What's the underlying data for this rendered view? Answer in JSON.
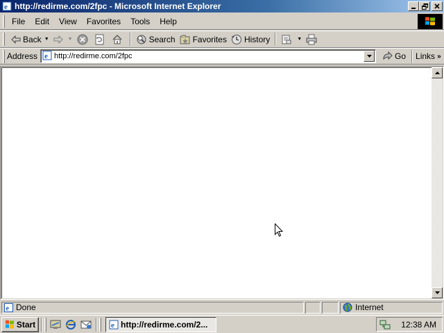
{
  "window": {
    "title": "http://redirme.com/2fpc - Microsoft Internet Explorer",
    "controls": [
      "minimize",
      "maximize",
      "close"
    ]
  },
  "menu": {
    "items": [
      "File",
      "Edit",
      "View",
      "Favorites",
      "Tools",
      "Help"
    ]
  },
  "toolbar": {
    "back_label": "Back",
    "search_label": "Search",
    "favorites_label": "Favorites",
    "history_label": "History"
  },
  "address": {
    "label": "Address",
    "url": "http://redirme.com/2fpc",
    "go_label": "Go",
    "links_label": "Links"
  },
  "status": {
    "text": "Done",
    "zone": "Internet"
  },
  "taskbar": {
    "start_label": "Start",
    "task_label": "http://redirme.com/2...",
    "clock": "12:38 AM"
  },
  "icons": {
    "ie": "ie-logo-icon",
    "back": "back-arrow-icon",
    "forward": "forward-arrow-icon",
    "stop": "stop-icon",
    "refresh": "refresh-icon",
    "home": "home-icon",
    "search": "search-icon",
    "favorites": "favorites-icon",
    "history": "history-icon",
    "mail": "mail-icon",
    "print": "print-icon",
    "go": "go-arrow-icon",
    "zone": "globe-icon"
  },
  "colors": {
    "titlebar_start": "#0a246a",
    "titlebar_end": "#a6caf0",
    "chrome": "#d4d0c8",
    "content_bg": "#ffffff"
  }
}
